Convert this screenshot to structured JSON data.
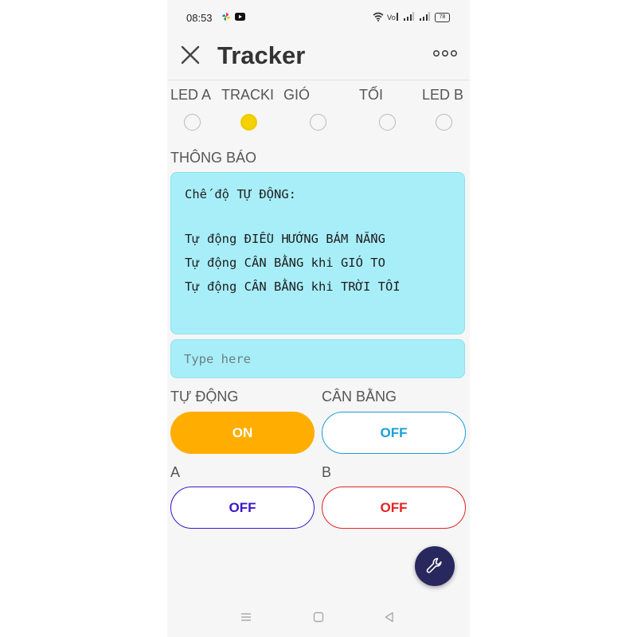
{
  "status_bar": {
    "time": "08:53",
    "battery": "78"
  },
  "header": {
    "title": "Tracker"
  },
  "segments": [
    {
      "label": "LED A",
      "selected": false
    },
    {
      "label": "TRACKI",
      "selected": true
    },
    {
      "label": "GIÓ",
      "selected": false
    },
    {
      "label": "TỐI",
      "selected": false
    },
    {
      "label": "LED B",
      "selected": false
    }
  ],
  "notification": {
    "label": "THÔNG BÁO",
    "lines": [
      "Chế độ TỰ ĐỘNG:",
      "",
      "Tự động ĐIỀU HƯỚNG BÁM NẮNG",
      "Tự động CÂN BẰNG khi GIÓ TO",
      "Tự động CÂN BẰNG khi TRỜI TỐI"
    ],
    "input_placeholder": "Type here",
    "input_value": ""
  },
  "switches": [
    {
      "label": "TỰ ĐỘNG",
      "state": "ON",
      "color": "#ffae00"
    },
    {
      "label": "CÂN BẰNG",
      "state": "OFF",
      "color": "#1a9fd6"
    },
    {
      "label": "A",
      "state": "OFF",
      "color": "#3a16c9"
    },
    {
      "label": "B",
      "state": "OFF",
      "color": "#e42424"
    }
  ],
  "colors": {
    "accent": "#ffae00",
    "terminal_bg": "#a8eef8",
    "radio_selected": "#f4d200",
    "fab": "#28285e"
  },
  "icons": {
    "close": "close-icon",
    "more": "more-icon",
    "fab": "wrench-icon",
    "nav": [
      "menu-icon",
      "home-square-icon",
      "back-triangle-icon"
    ]
  }
}
